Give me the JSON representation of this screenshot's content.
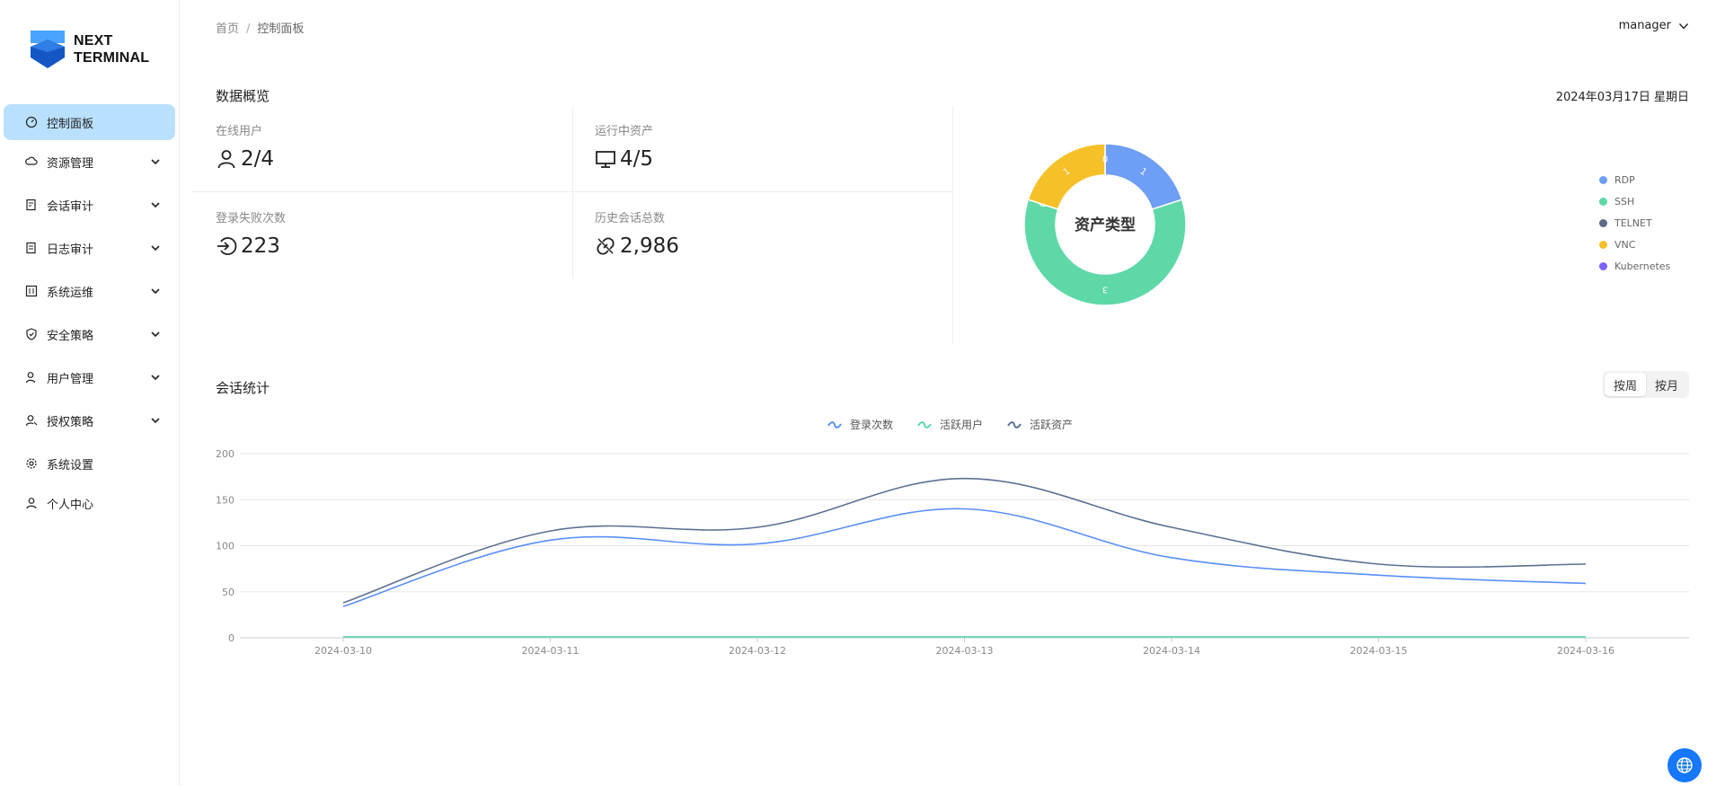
{
  "app": {
    "logo_line1": "NEXT",
    "logo_line2": "TERMINAL"
  },
  "sidebar": {
    "items": [
      {
        "label": "控制面板",
        "icon": "dashboard-icon",
        "active": true,
        "expandable": false
      },
      {
        "label": "资源管理",
        "icon": "cloud-icon",
        "active": false,
        "expandable": true
      },
      {
        "label": "会话审计",
        "icon": "audit-icon",
        "active": false,
        "expandable": true
      },
      {
        "label": "日志审计",
        "icon": "log-icon",
        "active": false,
        "expandable": true
      },
      {
        "label": "系统运维",
        "icon": "ops-icon",
        "active": false,
        "expandable": true
      },
      {
        "label": "安全策略",
        "icon": "shield-icon",
        "active": false,
        "expandable": true
      },
      {
        "label": "用户管理",
        "icon": "user-icon",
        "active": false,
        "expandable": true
      },
      {
        "label": "授权策略",
        "icon": "user-key-icon",
        "active": false,
        "expandable": true
      },
      {
        "label": "系统设置",
        "icon": "gear-icon",
        "active": false,
        "expandable": false
      },
      {
        "label": "个人中心",
        "icon": "person-icon",
        "active": false,
        "expandable": false
      }
    ]
  },
  "header": {
    "breadcrumb": [
      "首页",
      "控制面板"
    ],
    "separator": "/",
    "username": "manager"
  },
  "overview": {
    "title": "数据概览",
    "date": "2024年03月17日 星期日",
    "stats": [
      {
        "label": "在线用户",
        "value": "2/4",
        "icon": "user-icon"
      },
      {
        "label": "运行中资产",
        "value": "4/5",
        "icon": "monitor-icon"
      },
      {
        "label": "登录失败次数",
        "value": "223",
        "icon": "login-icon"
      },
      {
        "label": "历史会话总数",
        "value": "2,986",
        "icon": "link-icon"
      }
    ]
  },
  "asset_chart": {
    "center_label": "资产类型",
    "legend": [
      {
        "name": "RDP",
        "color": "#6e9ef5"
      },
      {
        "name": "SSH",
        "color": "#5fd8a8"
      },
      {
        "name": "TELNET",
        "color": "#5d6b86"
      },
      {
        "name": "VNC",
        "color": "#f6c028"
      },
      {
        "name": "Kubernetes",
        "color": "#7b61ff"
      }
    ]
  },
  "session": {
    "title": "会话统计",
    "toggle": {
      "week": "按周",
      "month": "按月",
      "selected": "week"
    },
    "legend": [
      {
        "name": "登录次数",
        "color": "#5b8ff9"
      },
      {
        "name": "活跃用户",
        "color": "#5ad8a6"
      },
      {
        "name": "活跃资产",
        "color": "#5d7092"
      }
    ]
  },
  "chart_data": [
    {
      "type": "pie",
      "title": "资产类型",
      "categories": [
        "RDP",
        "SSH",
        "TELNET",
        "VNC",
        "Kubernetes"
      ],
      "values": [
        1,
        3,
        0,
        1,
        0
      ],
      "colors": [
        "#6e9ef5",
        "#5fd8a8",
        "#5d6b86",
        "#f6c028",
        "#7b61ff"
      ],
      "legend": "right"
    },
    {
      "type": "line",
      "title": "会话统计",
      "x": [
        "2024-03-10",
        "2024-03-11",
        "2024-03-12",
        "2024-03-13",
        "2024-03-14",
        "2024-03-15",
        "2024-03-16"
      ],
      "series": [
        {
          "name": "登录次数",
          "values": [
            34,
            106,
            102,
            140,
            87,
            68,
            59
          ],
          "color": "#5b8ff9"
        },
        {
          "name": "活跃用户",
          "values": [
            1,
            1,
            1,
            1,
            1,
            1,
            1
          ],
          "color": "#5ad8a6"
        },
        {
          "name": "活跃资产",
          "values": [
            38,
            116,
            120,
            173,
            120,
            80,
            80
          ],
          "color": "#5d7092"
        }
      ],
      "ylim": [
        0,
        200
      ],
      "yticks": [
        0,
        50,
        100,
        150,
        200
      ],
      "grid": true,
      "legend": "top-center"
    }
  ]
}
